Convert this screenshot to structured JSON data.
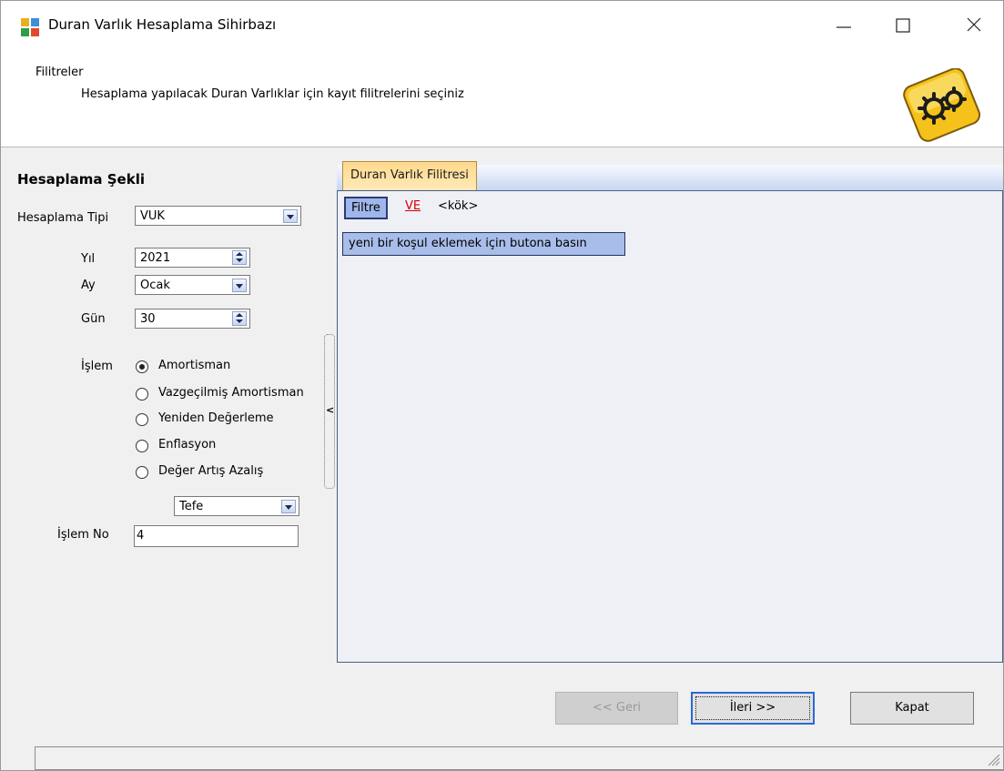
{
  "window": {
    "title": "Duran Varlık Hesaplama Sihirbazı",
    "icons": {
      "app": "app-icon",
      "minimize": "minimize-icon",
      "maximize": "maximize-icon",
      "close": "close-icon"
    }
  },
  "header": {
    "title": "Filitreler",
    "subtitle": "Hesaplama yapılacak Duran Varlıklar için kayıt filitrelerini seçiniz",
    "icon": "gears-icon"
  },
  "left_panel": {
    "title": "Hesaplama Şekli",
    "calc_type": {
      "label": "Hesaplama Tipi",
      "value": "VUK"
    },
    "year": {
      "label": "Yıl",
      "value": "2021"
    },
    "month": {
      "label": "Ay",
      "value": "Ocak"
    },
    "day": {
      "label": "Gün",
      "value": "30"
    },
    "operation": {
      "label": "İşlem",
      "options": [
        {
          "label": "Amortisman",
          "selected": true
        },
        {
          "label": "Vazgeçilmiş Amortisman",
          "selected": false
        },
        {
          "label": "Yeniden Değerleme",
          "selected": false
        },
        {
          "label": "Enflasyon",
          "selected": false
        },
        {
          "label": "Değer Artış Azalış",
          "selected": false
        }
      ],
      "index_type": "Tefe"
    },
    "operation_no": {
      "label": "İşlem No",
      "value": "4"
    }
  },
  "filter_panel": {
    "tab_label": "Duran Varlık Filitresi",
    "filter_button": "Filtre",
    "operator_link": "VE",
    "root_text": "<kök>",
    "hint": "yeni bir koşul eklemek için butona basın"
  },
  "buttons": {
    "back": "<< Geri",
    "next": "İleri >>",
    "close": "Kapat"
  },
  "colors": {
    "tab_accent": "#ffd98c",
    "filter_chip": "#9fb6ea",
    "operator_link": "#d30000"
  }
}
